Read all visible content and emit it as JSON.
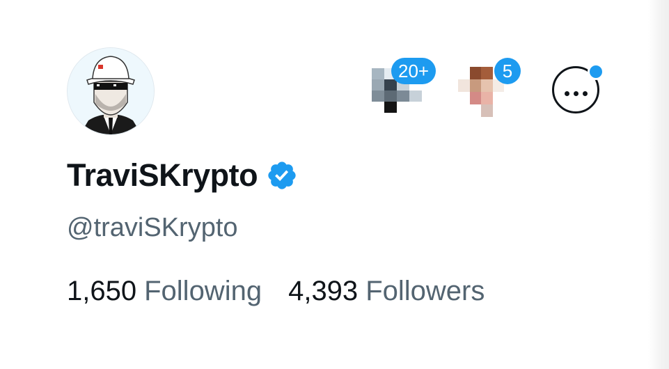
{
  "profile": {
    "display_name": "TraviSKrypto",
    "handle": "@traviSKrypto",
    "verified": true,
    "avatar_icon": "cartoon-avatar-bucket-hat-sunglasses",
    "accent_color": "#1d9bf0"
  },
  "stats": {
    "following_count": "1,650",
    "following_label": "Following",
    "followers_count": "4,393",
    "followers_label": "Followers"
  },
  "header_actions": {
    "notification_1_badge": "20+",
    "notification_2_badge": "5",
    "more_icon": "more-horizontal-icon"
  }
}
